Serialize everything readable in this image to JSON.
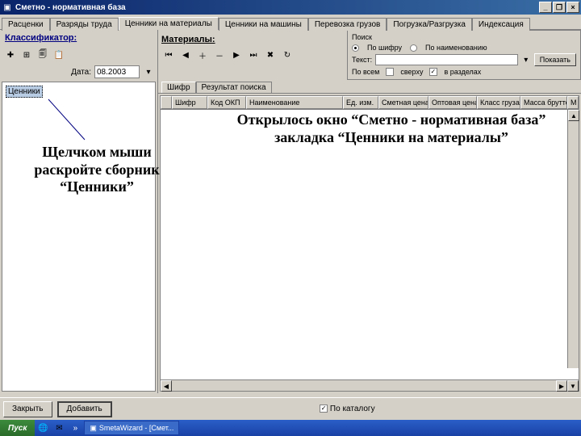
{
  "window": {
    "title": "Сметно - нормативная база",
    "min": "_",
    "restore": "❐",
    "close": "×"
  },
  "tabs": [
    "Расценки",
    "Разряды труда",
    "Ценники на материалы",
    "Ценники на машины",
    "Перевозка грузов",
    "Погрузка/Разгрузка",
    "Индексация"
  ],
  "active_tab_index": 2,
  "left": {
    "header": "Классификатор:",
    "date_label": "Дата:",
    "date_value": "08.2003",
    "tree_root": "Ценники"
  },
  "right": {
    "header": "Материалы:",
    "search": {
      "group_label": "Поиск",
      "radio_shifr": "По шифру",
      "radio_name": "По наименованию",
      "text_label": "Текст:",
      "text_value": "",
      "go_label": "Показать",
      "opt_all": "По всем",
      "opt_down": "сверху",
      "opt_section": "в разделах"
    },
    "subtabs": [
      "Шифр",
      "Результат поиска"
    ],
    "columns": [
      "Шифр",
      "Код ОКП",
      "Наименование",
      "Ед. изм.",
      "Сметная цена",
      "Оптовая цена",
      "Класс груза",
      "Масса брутто",
      "М"
    ]
  },
  "bottom": {
    "close_btn": "Закрыть",
    "select_btn": "Добавить",
    "catalog_chk": "По каталогу"
  },
  "taskbar": {
    "start": "Пуск",
    "app": "SmetaWizard - [Смет..."
  },
  "callouts": {
    "main": "Открылось окно “Сметно - нормативная база” закладка “Ценники на материалы”",
    "left": "Щелчком мыши раскройте сборник “Ценники”"
  },
  "icons": {
    "app": "▣",
    "tree1": "✚",
    "tree2": "⊞",
    "tree3": "🗐",
    "tree4": "📋",
    "nav_first": "⏮",
    "nav_prev": "◀",
    "nav_add": "＋",
    "nav_del": "－",
    "nav_next": "▶",
    "nav_last": "⏭",
    "nav_cancel": "✖",
    "nav_refresh": "↻",
    "dropdown": "▾",
    "up": "▲",
    "down": "▼",
    "left_a": "◀",
    "right_a": "▶"
  }
}
